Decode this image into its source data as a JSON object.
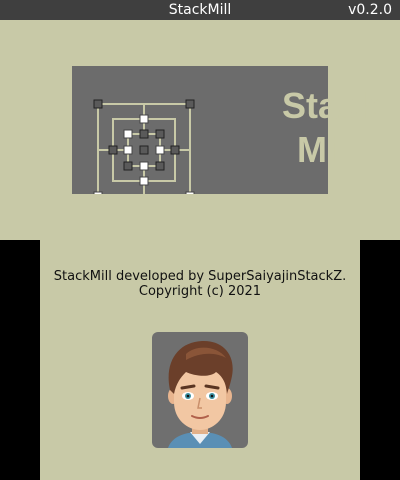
{
  "window": {
    "title": "StackMill",
    "version": "v0.2.0"
  },
  "logo": {
    "line1": "Stack",
    "line2": "Mill"
  },
  "credits": {
    "line1": "StackMill developed by SuperSaiyajinStackZ.",
    "line2": "Copyright (c) 2021"
  },
  "icons": {
    "board": "mill-board-icon",
    "avatar": "developer-avatar"
  },
  "colors": {
    "background": "#c8c9a7",
    "logo_bg": "#6c6c6c",
    "titlebar": "#3f3f3f"
  }
}
